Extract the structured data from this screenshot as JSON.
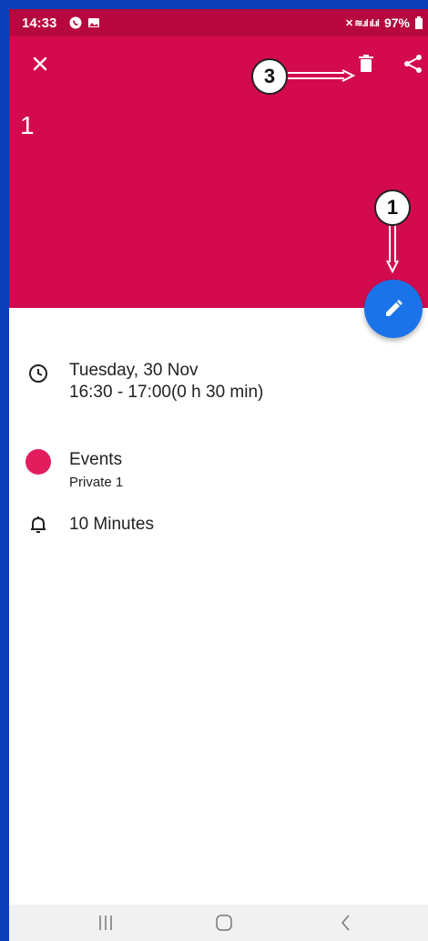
{
  "status_bar": {
    "time": "14:33",
    "battery": "97%"
  },
  "event": {
    "title": "1",
    "date": "Tuesday, 30 Nov",
    "time_range": "16:30 - 17:00(0 h 30 min)",
    "calendar_name": "Events",
    "calendar_account": "Private 1",
    "reminder": "10 Minutes",
    "color": "#d30a4e"
  },
  "annotations": {
    "delete_marker": "3",
    "edit_marker": "1"
  },
  "icons": {
    "close": "close-icon",
    "delete": "trash-icon",
    "share": "share-icon",
    "edit": "pencil-icon",
    "time": "clock-icon",
    "reminder": "bell-icon"
  },
  "colors": {
    "header": "#d30a4e",
    "status_bar": "#b6083f",
    "fab": "#1a73e8",
    "border": "#0a3fb8"
  }
}
